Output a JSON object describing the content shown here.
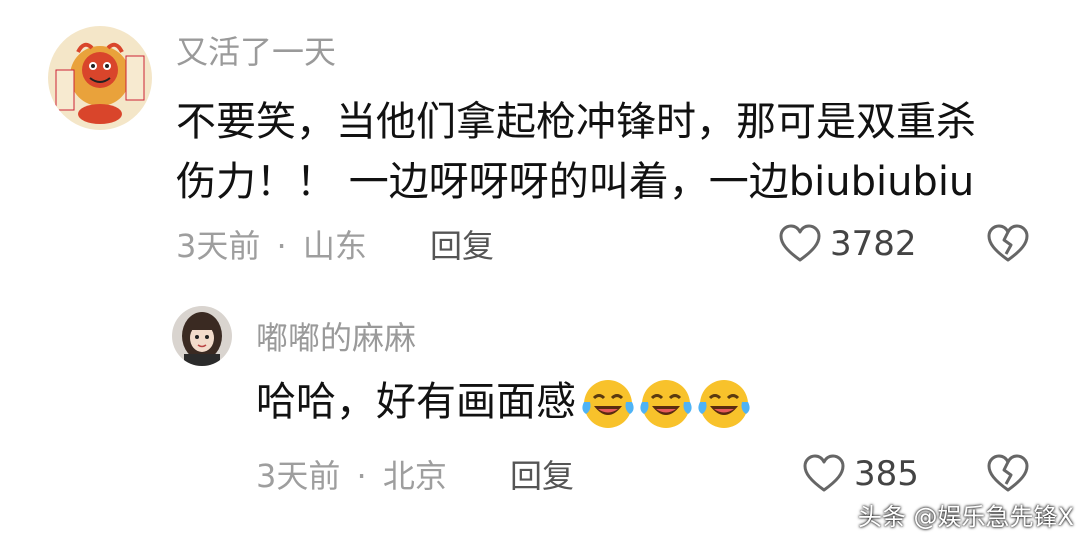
{
  "comments": [
    {
      "username": "又活了一天",
      "text_line1": "不要笑，当他们拿起枪冲锋时，那可是双重杀",
      "text_line2": "伤力！！   一边呀呀呀的叫着，一边biubiubiu",
      "time": "3天前",
      "separator": "·",
      "location": "山东",
      "reply_label": "回复",
      "likes": "3782",
      "avatar_icon": "lion-dance-sticker-avatar"
    }
  ],
  "replies": [
    {
      "username": "嘟嘟的麻麻",
      "text": "哈哈，好有画面感",
      "emojis": [
        "laughing-crying-emoji",
        "laughing-crying-emoji",
        "laughing-crying-emoji"
      ],
      "time": "3天前",
      "separator": "·",
      "location": "北京",
      "reply_label": "回复",
      "likes": "385",
      "avatar_icon": "girl-photo-avatar"
    }
  ],
  "watermark": "头条 @娱乐急先锋X",
  "colors": {
    "username": "#9a9a9a",
    "text": "#111111",
    "meta": "#9e9e9e",
    "reply": "#555555",
    "icon": "#666666"
  }
}
